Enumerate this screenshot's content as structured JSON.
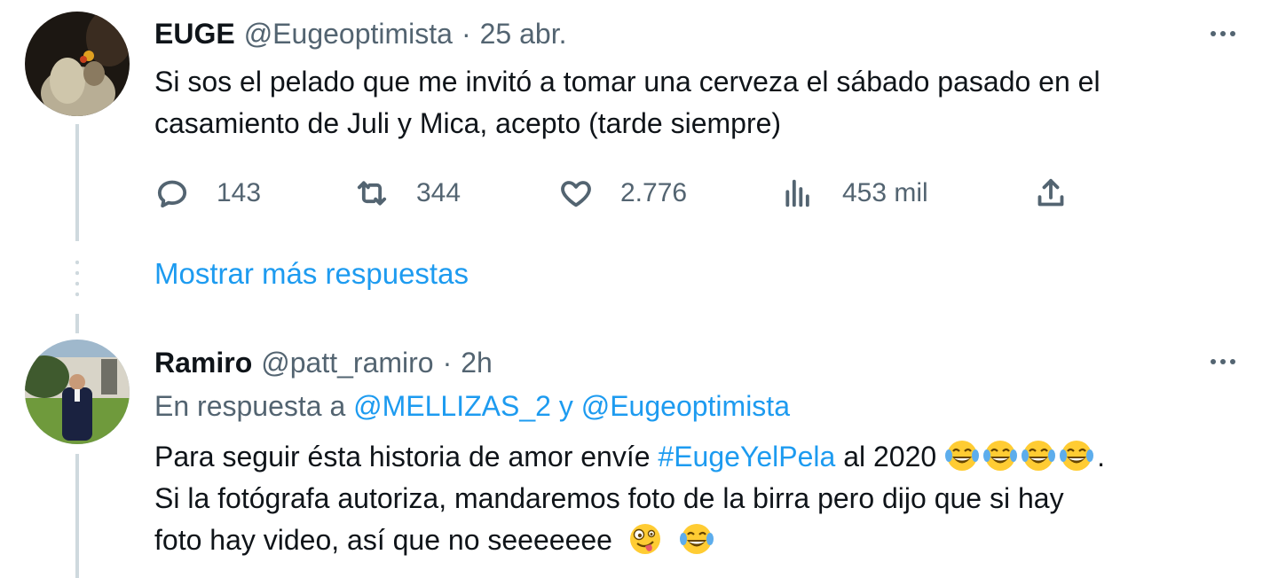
{
  "tweet1": {
    "name": "EUGE",
    "handle": "@Eugeoptimista",
    "separator": "·",
    "time": "25 abr.",
    "text_line1": "Si sos el pelado que me invitó a tomar una cerveza el sábado pasado en el",
    "text_line2": "casamiento de Juli y Mica, acepto (tarde siempre)",
    "actions": {
      "replies": "143",
      "retweets": "344",
      "likes": "2.776",
      "views": "453 mil"
    }
  },
  "show_more_replies": "Mostrar más respuestas",
  "tweet2": {
    "name": "Ramiro",
    "handle": "@patt_ramiro",
    "separator": "·",
    "time": "2h",
    "reply_to_prefix": "En respuesta a",
    "reply_to_user1": "@MELLIZAS_2",
    "reply_to_conj": "y",
    "reply_to_user2": "@Eugeoptimista",
    "line1_before": "Para seguir ésta historia de amor envíe",
    "hashtag": "#EugeYelPela",
    "line1_after": "al 2020",
    "line1_end": ".",
    "text_line2": "Si la fotógrafa autoriza, mandaremos foto de la birra pero dijo que si hay",
    "text_line3": "foto hay video, así que no seeeeeee",
    "emojis_line1": [
      "tears-of-joy",
      "tears-of-joy",
      "tears-of-joy",
      "tears-of-joy"
    ],
    "emojis_line3": [
      "zany-face",
      "tears-of-joy"
    ]
  },
  "colors": {
    "link": "#1d9bf0",
    "secondary_text": "#536471",
    "primary_text": "#0f1419",
    "thread_line": "#cfd9de"
  }
}
